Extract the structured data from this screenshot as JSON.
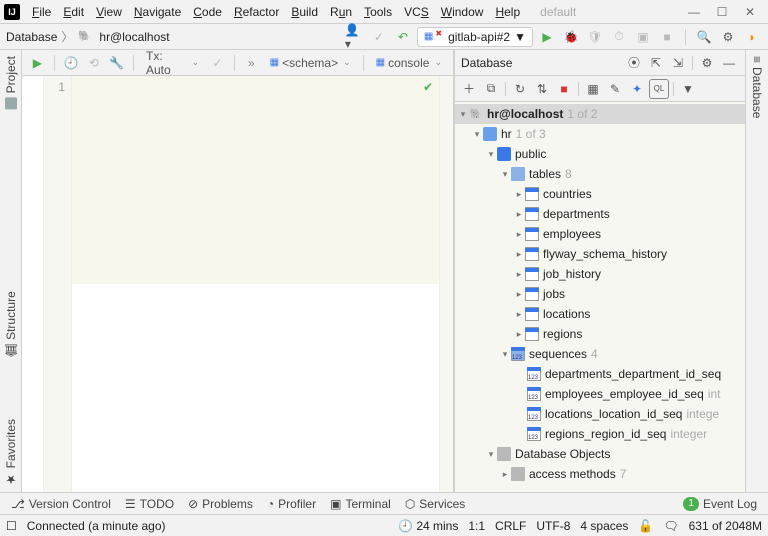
{
  "menu": {
    "items": [
      "File",
      "Edit",
      "View",
      "Navigate",
      "Code",
      "Refactor",
      "Build",
      "Run",
      "Tools",
      "VCS",
      "Window",
      "Help"
    ],
    "project": "default"
  },
  "nav": {
    "root": "Database",
    "item": "hr@localhost"
  },
  "runconfig": {
    "label": "gitlab-api#2"
  },
  "editor_tools": {
    "tx": "Tx: Auto",
    "schema": "<schema>",
    "console": "console"
  },
  "gutter": {
    "line1": "1"
  },
  "dbpanel": {
    "title": "Database",
    "root": {
      "label": "hr@localhost",
      "note": "1 of 2"
    },
    "db": {
      "label": "hr",
      "note": "1 of 3"
    },
    "schema": {
      "label": "public"
    },
    "tables_group": {
      "label": "tables",
      "count": "8"
    },
    "tables": [
      "countries",
      "departments",
      "employees",
      "flyway_schema_history",
      "job_history",
      "jobs",
      "locations",
      "regions"
    ],
    "sequences_group": {
      "label": "sequences",
      "count": "4"
    },
    "sequences": [
      {
        "name": "departments_department_id_seq",
        "type": ""
      },
      {
        "name": "employees_employee_id_seq",
        "type": "int"
      },
      {
        "name": "locations_location_id_seq",
        "type": "intege"
      },
      {
        "name": "regions_region_id_seq",
        "type": "integer"
      }
    ],
    "dbobjects": {
      "label": "Database Objects"
    },
    "access": {
      "label": "access methods",
      "count": "7"
    }
  },
  "sidetabs": {
    "project": "Project",
    "structure": "Structure",
    "favorites": "Favorites",
    "database": "Database"
  },
  "bottom": {
    "vc": "Version Control",
    "todo": "TODO",
    "problems": "Problems",
    "profiler": "Profiler",
    "terminal": "Terminal",
    "services": "Services",
    "eventlog": "Event Log",
    "event_count": "1"
  },
  "status": {
    "msg": "Connected (a minute ago)",
    "time": "24 mins",
    "pos": "1:1",
    "le": "CRLF",
    "enc": "UTF-8",
    "indent": "4 spaces",
    "mem": "631 of 2048M"
  }
}
